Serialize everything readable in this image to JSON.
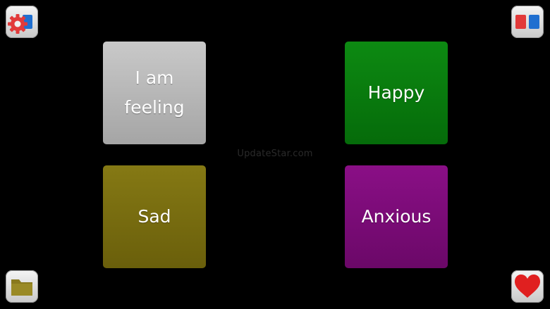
{
  "tiles": {
    "i_am_feeling": {
      "label": "I am feeling",
      "color": "#b8b8b8"
    },
    "happy": {
      "label": "Happy",
      "color": "#0a7c0f"
    },
    "sad": {
      "label": "Sad",
      "color": "#7a6e10"
    },
    "anxious": {
      "label": "Anxious",
      "color": "#7c0c79"
    }
  },
  "watermark": {
    "text": "UpdateStar.com"
  },
  "corner_buttons": {
    "settings": {
      "icon": "gear-icon"
    },
    "layout": {
      "icon": "two-panel-icon"
    },
    "folder": {
      "icon": "folder-icon"
    },
    "favorite": {
      "icon": "heart-icon"
    }
  },
  "colors": {
    "background": "#000000",
    "accent_red": "#e23a3a",
    "accent_blue": "#1f6fd0",
    "folder": "#8a7a1e",
    "heart": "#e02020"
  }
}
